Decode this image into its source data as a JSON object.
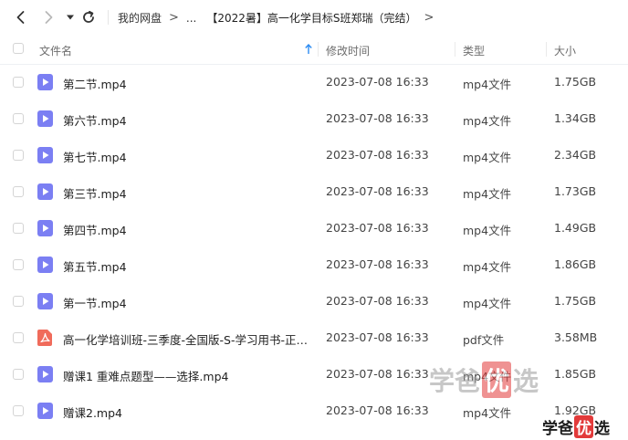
{
  "nav": {
    "breadcrumbs": [
      "我的网盘",
      "...",
      "【2022暑】高一化学目标S班郑瑞（完结）"
    ],
    "chevron": ">"
  },
  "table": {
    "columns": {
      "name": "文件名",
      "modified": "修改时间",
      "type": "类型",
      "size": "大小"
    },
    "rows": [
      {
        "name": "第二节.mp4",
        "modified": "2023-07-08 16:33",
        "type": "mp4文件",
        "size": "1.75GB",
        "icon": "video-file-icon"
      },
      {
        "name": "第六节.mp4",
        "modified": "2023-07-08 16:33",
        "type": "mp4文件",
        "size": "1.34GB",
        "icon": "video-file-icon"
      },
      {
        "name": "第七节.mp4",
        "modified": "2023-07-08 16:33",
        "type": "mp4文件",
        "size": "2.34GB",
        "icon": "video-file-icon"
      },
      {
        "name": "第三节.mp4",
        "modified": "2023-07-08 16:33",
        "type": "mp4文件",
        "size": "1.73GB",
        "icon": "video-file-icon"
      },
      {
        "name": "第四节.mp4",
        "modified": "2023-07-08 16:33",
        "type": "mp4文件",
        "size": "1.49GB",
        "icon": "video-file-icon"
      },
      {
        "name": "第五节.mp4",
        "modified": "2023-07-08 16:33",
        "type": "mp4文件",
        "size": "1.86GB",
        "icon": "video-file-icon"
      },
      {
        "name": "第一节.mp4",
        "modified": "2023-07-08 16:33",
        "type": "mp4文件",
        "size": "1.75GB",
        "icon": "video-file-icon"
      },
      {
        "name": "高一化学培训班-三季度-全国版-S-学习用书-正文...",
        "modified": "2023-07-08 16:33",
        "type": "pdf文件",
        "size": "3.58MB",
        "icon": "pdf-file-icon"
      },
      {
        "name": "赠课1 重难点题型——选择.mp4",
        "modified": "2023-07-08 16:33",
        "type": "mp4文件",
        "size": "1.85GB",
        "icon": "video-file-icon"
      },
      {
        "name": "赠课2.mp4",
        "modified": "2023-07-08 16:33",
        "type": "mp4文件",
        "size": "1.92GB",
        "icon": "video-file-icon"
      }
    ]
  },
  "watermark": {
    "part1": "学爸",
    "part2": "优",
    "part3": "选"
  },
  "logo": {
    "part1": "学爸",
    "part2": "优",
    "part3": "选"
  },
  "colors": {
    "video_icon": "#7b7ff3",
    "pdf_icon": "#f06b5b",
    "brand_red": "#e23a3a",
    "accent_blue": "#2b8bf2"
  }
}
